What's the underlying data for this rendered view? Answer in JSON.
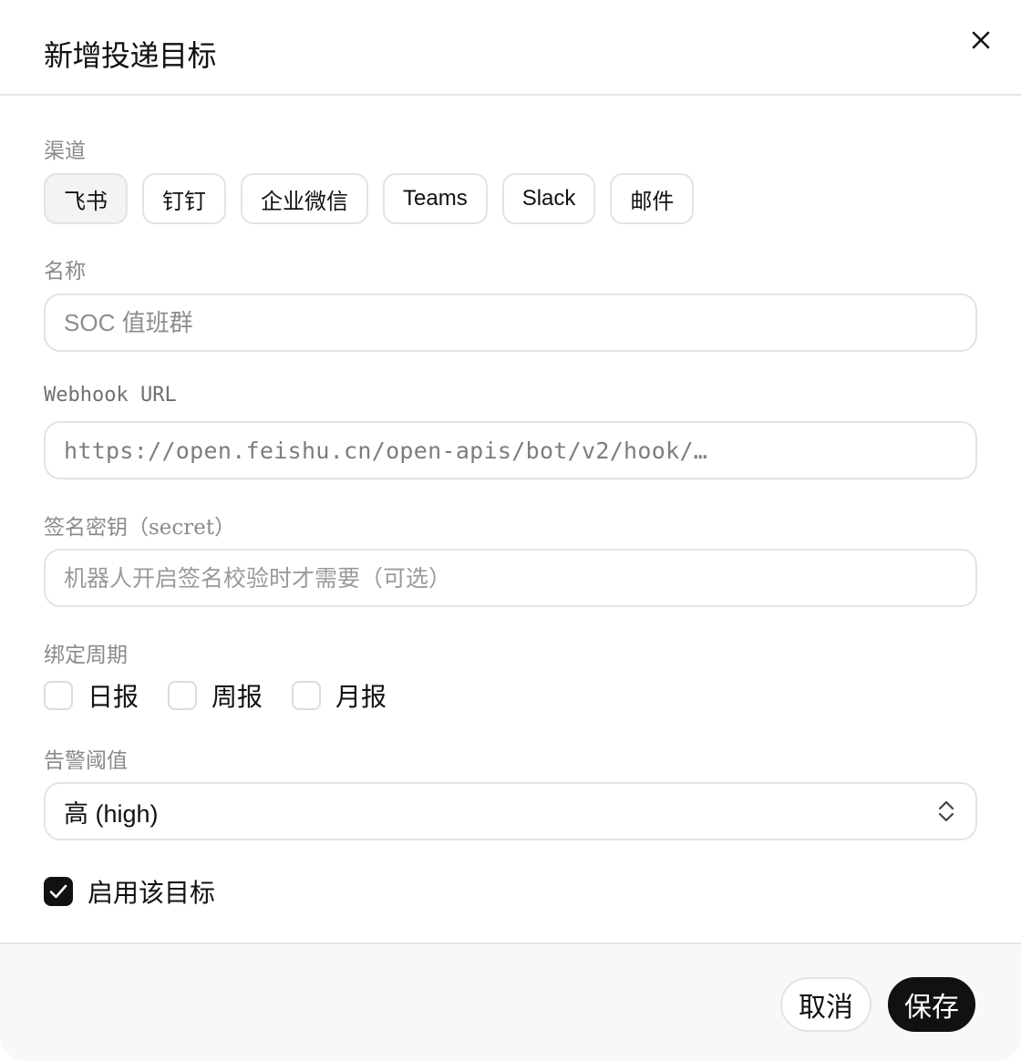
{
  "dialog": {
    "title": "新增投递目标",
    "close_icon": "close-icon"
  },
  "channel": {
    "label": "渠道",
    "options": [
      "飞书",
      "钉钉",
      "企业微信",
      "Teams",
      "Slack",
      "邮件"
    ],
    "selected": "飞书"
  },
  "name": {
    "label": "名称",
    "placeholder": "SOC 值班群",
    "value": ""
  },
  "webhook": {
    "label": "Webhook URL",
    "placeholder": "https://open.feishu.cn/open-apis/bot/v2/hook/…",
    "value": ""
  },
  "secret": {
    "label": "签名密钥（secret）",
    "placeholder": "机器人开启签名校验时才需要（可选）",
    "value": ""
  },
  "period": {
    "label": "绑定周期",
    "options": [
      {
        "label": "日报",
        "checked": false
      },
      {
        "label": "周报",
        "checked": false
      },
      {
        "label": "月报",
        "checked": false
      }
    ]
  },
  "threshold": {
    "label": "告警阈值",
    "value": "高 (high)",
    "icon": "chevron-up-down-icon"
  },
  "enable": {
    "label": "启用该目标",
    "checked": true,
    "icon": "checkmark-icon"
  },
  "footer": {
    "cancel_label": "取消",
    "save_label": "保存"
  }
}
